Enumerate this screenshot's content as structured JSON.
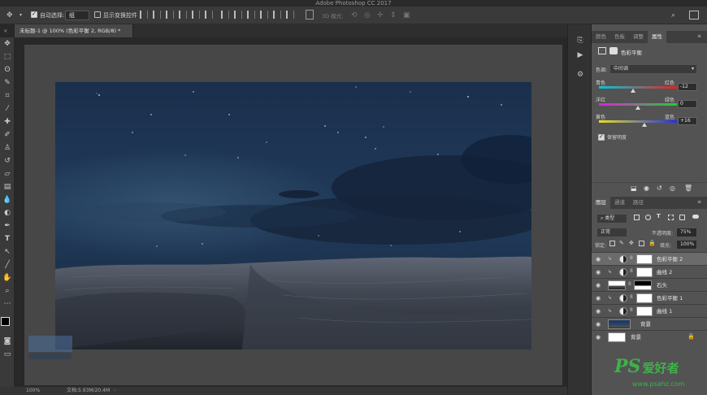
{
  "app": {
    "title": "Adobe Photoshop CC 2017"
  },
  "options_bar": {
    "auto_select_label": "自动选择:",
    "auto_select_value": "组",
    "show_transform_label": "显示变换控件",
    "mode_3d_label": "3D 模式:"
  },
  "document": {
    "tab_title": "未标题-1 @ 100% (色彩平衡 2, RGB/8) *"
  },
  "status": {
    "zoom": "100%",
    "doc_size": "文档:5.93M/20.4M"
  },
  "properties_panel": {
    "tabs": [
      "颜色",
      "色板",
      "调整",
      "属性"
    ],
    "active_tab": 3,
    "header_title": "色彩平衡",
    "tone_label": "色调:",
    "tone_value": "中间调",
    "sliders": [
      {
        "left": "青色",
        "right": "红色",
        "value": "-12",
        "level": 0.44
      },
      {
        "left": "洋红",
        "right": "绿色",
        "value": "0",
        "level": 0.5
      },
      {
        "left": "黄色",
        "right": "蓝色",
        "value": "+16",
        "level": 0.58
      }
    ],
    "preserve_luminosity": "保留明度",
    "preserve_checked": true
  },
  "layers_panel": {
    "tabs": [
      "图层",
      "通道",
      "路径"
    ],
    "active_tab": 0,
    "filter_label": "类型",
    "blend_mode": "正常",
    "opacity_label": "不透明度:",
    "opacity_value": "75%",
    "lock_label": "锁定:",
    "fill_label": "填充:",
    "fill_value": "100%",
    "layers": [
      {
        "name": "色彩平衡 2",
        "kind": "adjustment",
        "selected": true,
        "clipped": true
      },
      {
        "name": "曲线 2",
        "kind": "adjustment",
        "selected": false,
        "clipped": true
      },
      {
        "name": "石头",
        "kind": "image-stone",
        "selected": false,
        "clipped": false
      },
      {
        "name": "色彩平衡 1",
        "kind": "adjustment",
        "selected": false,
        "clipped": true
      },
      {
        "name": "曲线 1",
        "kind": "adjustment",
        "selected": false,
        "clipped": true
      },
      {
        "name": "背景",
        "kind": "image-sky",
        "selected": false,
        "clipped": false
      },
      {
        "name": "背景",
        "kind": "background",
        "selected": false,
        "clipped": false
      }
    ]
  },
  "watermark": {
    "logo": "PS",
    "text": "爱好者",
    "url": "www.psahz.com"
  },
  "colors": {
    "ui_dark": "#282828",
    "ui_panel": "#535353",
    "selected_layer": "#6b6b6b",
    "sky": "#1d3454",
    "watermark_green": "#3db24a"
  }
}
